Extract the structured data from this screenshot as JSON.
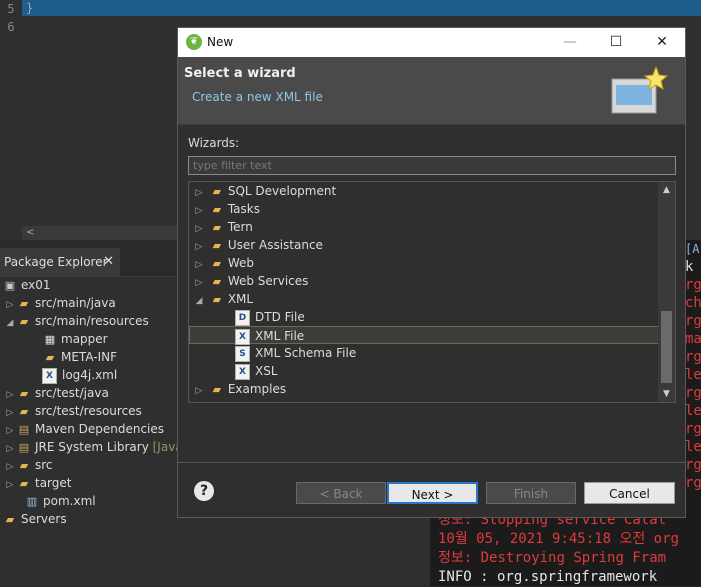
{
  "editor": {
    "line_numbers": [
      "5",
      "6"
    ],
    "code_line": "}",
    "scroll_arrow": "<"
  },
  "package_explorer": {
    "tab_label": "Package Explorer",
    "close_glyph": "✕",
    "items": [
      {
        "label": "ex01",
        "expander": "",
        "decoration": ""
      },
      {
        "label": "src/main/java",
        "expander": "▷",
        "decoration": ""
      },
      {
        "label": "src/main/resources",
        "expander": "◢",
        "decoration": ""
      },
      {
        "label": "mapper",
        "expander": "",
        "decoration": ""
      },
      {
        "label": "META-INF",
        "expander": "",
        "decoration": ""
      },
      {
        "label": "log4j.xml",
        "expander": "",
        "decoration": ""
      },
      {
        "label": "src/test/java",
        "expander": "▷",
        "decoration": ""
      },
      {
        "label": "src/test/resources",
        "expander": "▷",
        "decoration": ""
      },
      {
        "label": "Maven Dependencies",
        "expander": "▷",
        "decoration": ""
      },
      {
        "label": "JRE System Library",
        "expander": "▷",
        "decoration": "[JavaS"
      },
      {
        "label": "src",
        "expander": "▷",
        "decoration": ""
      },
      {
        "label": "target",
        "expander": "▷",
        "decoration": ""
      },
      {
        "label": "pom.xml",
        "expander": "",
        "decoration": ""
      },
      {
        "label": "Servers",
        "expander": "",
        "decoration": ""
      }
    ]
  },
  "console": {
    "right_strip": [
      "[A",
      "k",
      "rg",
      "ch",
      "rg",
      "ma",
      "rg",
      "le",
      "rg",
      "le",
      "rg",
      "le",
      "rg",
      "rg"
    ],
    "lines": [
      {
        "text": "정보: Stopping service Catal",
        "color": "red"
      },
      {
        "text": "10월 05, 2021 9:45:18 오전 org",
        "color": "red"
      },
      {
        "text": "정보: Destroying Spring Fram",
        "color": "red"
      },
      {
        "text": "INFO : org.springframework",
        "color": "white"
      }
    ]
  },
  "dialog": {
    "title": "New",
    "title_controls": {
      "minimize": "—",
      "maximize": "☐",
      "close": "✕"
    },
    "header_title": "Select a wizard",
    "header_subtitle": "Create a new XML file",
    "wizards_label": "Wizards:",
    "filter_placeholder": "type filter text",
    "tree": [
      {
        "label": "SQL Development",
        "expander": "▷",
        "indent": 0,
        "kind": "folder"
      },
      {
        "label": "Tasks",
        "expander": "▷",
        "indent": 0,
        "kind": "folder"
      },
      {
        "label": "Tern",
        "expander": "▷",
        "indent": 0,
        "kind": "folder"
      },
      {
        "label": "User Assistance",
        "expander": "▷",
        "indent": 0,
        "kind": "folder"
      },
      {
        "label": "Web",
        "expander": "▷",
        "indent": 0,
        "kind": "folder"
      },
      {
        "label": "Web Services",
        "expander": "▷",
        "indent": 0,
        "kind": "folder"
      },
      {
        "label": "XML",
        "expander": "◢",
        "indent": 0,
        "kind": "folder"
      },
      {
        "label": "DTD File",
        "expander": "",
        "indent": 1,
        "kind": "file",
        "badge": "D"
      },
      {
        "label": "XML File",
        "expander": "",
        "indent": 1,
        "kind": "file",
        "badge": "X",
        "selected": true
      },
      {
        "label": "XML Schema File",
        "expander": "",
        "indent": 1,
        "kind": "file",
        "badge": "S"
      },
      {
        "label": "XSL",
        "expander": "",
        "indent": 1,
        "kind": "file",
        "badge": "X"
      },
      {
        "label": "Examples",
        "expander": "▷",
        "indent": 0,
        "kind": "folder"
      }
    ],
    "scroll_up": "▲",
    "scroll_down": "▼",
    "help_glyph": "?",
    "buttons": {
      "back": "< Back",
      "next": "Next >",
      "finish": "Finish",
      "cancel": "Cancel"
    }
  },
  "colors": {
    "accent": "#2a77c9",
    "console_red": "#e03a3a",
    "link": "#8fc6e8",
    "spring_green": "#6db33f"
  }
}
